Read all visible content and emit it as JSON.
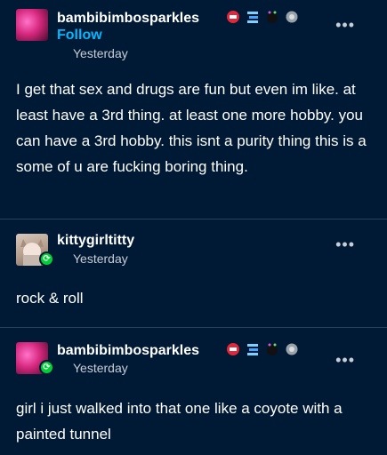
{
  "posts": [
    {
      "username": "bambibimbosparkles",
      "follow_label": "Follow",
      "timestamp": "Yesterday",
      "text": "I get that sex and drugs are fun but even im like. at least have a 3rd thing. at least one more hobby. you can have a 3rd hobby. this isnt a purity thing this is a some of u are fucking boring thing.",
      "badges": [
        "red-badge",
        "blue-badge",
        "black-badge",
        "gray-badge"
      ]
    },
    {
      "username": "kittygirltitty",
      "timestamp": "Yesterday",
      "text": "rock & roll"
    },
    {
      "username": "bambibimbosparkles",
      "timestamp": "Yesterday",
      "text": "girl i just walked into that one like a coyote with a painted tunnel",
      "badges": [
        "red-badge",
        "blue-badge",
        "black-badge",
        "gray-badge"
      ]
    }
  ],
  "ui": {
    "more_label": "•••"
  },
  "colors": {
    "background": "#001935",
    "follow": "#00b8ff",
    "reblog": "#00cf35",
    "divider": "#2a3f5a"
  }
}
